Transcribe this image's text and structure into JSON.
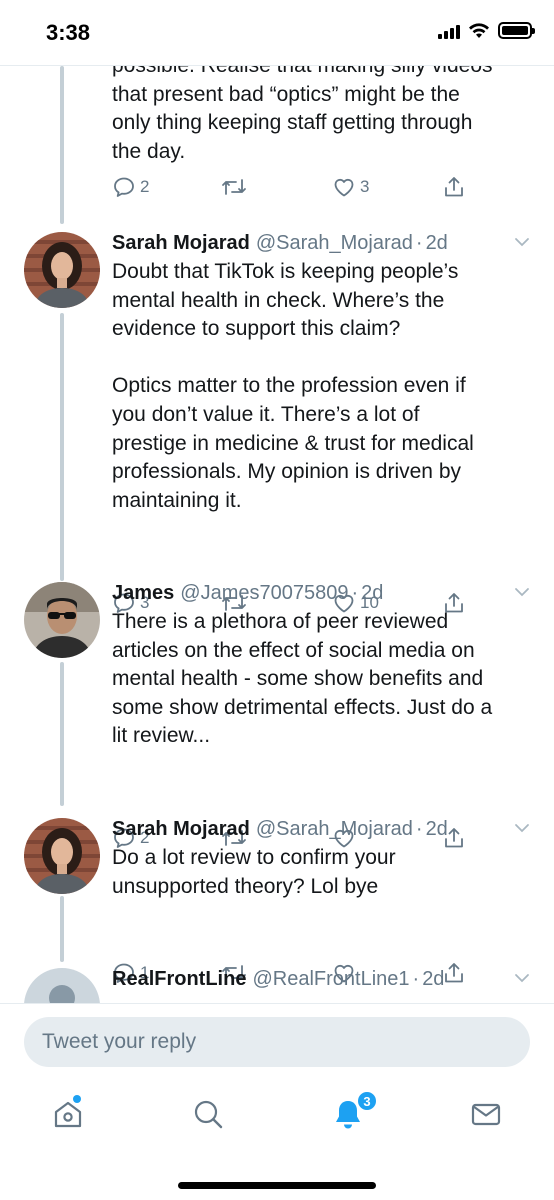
{
  "status_bar": {
    "time": "3:38"
  },
  "colors": {
    "accent": "#1da1f2",
    "text": "#14171a",
    "muted": "#657786",
    "thread": "#c4cfd6"
  },
  "partial_tweet": {
    "text": "possible. Realise that making silly videos\nthat present bad “optics” might be the\nonly thing keeping staff getting through\nthe day.",
    "replies": "2",
    "retweets": "",
    "likes": "3"
  },
  "tweets": [
    {
      "name": "Sarah Mojarad",
      "handle": "@Sarah_Mojarad",
      "separator": "·",
      "time": "2d",
      "text": "Doubt that TikTok is keeping people’s\nmental health in check. Where’s the\nevidence to support this claim?\n\nOptics matter to the profession even if\nyou don’t value it. There’s a lot of\nprestige in medicine & trust for medical\nprofessionals. My opinion is driven by\nmaintaining it.",
      "replies": "3",
      "retweets": "",
      "likes": "10"
    },
    {
      "name": "James",
      "handle": "@James70075809",
      "separator": "·",
      "time": "2d",
      "text": "There is a plethora of peer reviewed\narticles on the effect of social media on\nmental health - some show benefits and\nsome show detrimental effects. Just do a\nlit review...",
      "replies": "2",
      "retweets": "",
      "likes": ""
    },
    {
      "name": "Sarah Mojarad",
      "handle": "@Sarah_Mojarad",
      "separator": "·",
      "time": "2d",
      "text": "Do a lot review to confirm your\nunsupported theory? Lol bye",
      "replies": "1",
      "retweets": "",
      "likes": ""
    },
    {
      "name": "RealFrontLine",
      "handle": "@RealFrontLine1",
      "separator": "·",
      "time": "2d",
      "text": "",
      "replies": "",
      "retweets": "",
      "likes": ""
    }
  ],
  "reply_bar": {
    "placeholder": "Tweet your reply"
  },
  "tab_bar": {
    "items": [
      {
        "icon": "home-icon",
        "has_dot": true
      },
      {
        "icon": "search-icon"
      },
      {
        "icon": "notifications-bell-icon",
        "badge": "3",
        "active": true
      },
      {
        "icon": "messages-envelope-icon"
      }
    ]
  }
}
